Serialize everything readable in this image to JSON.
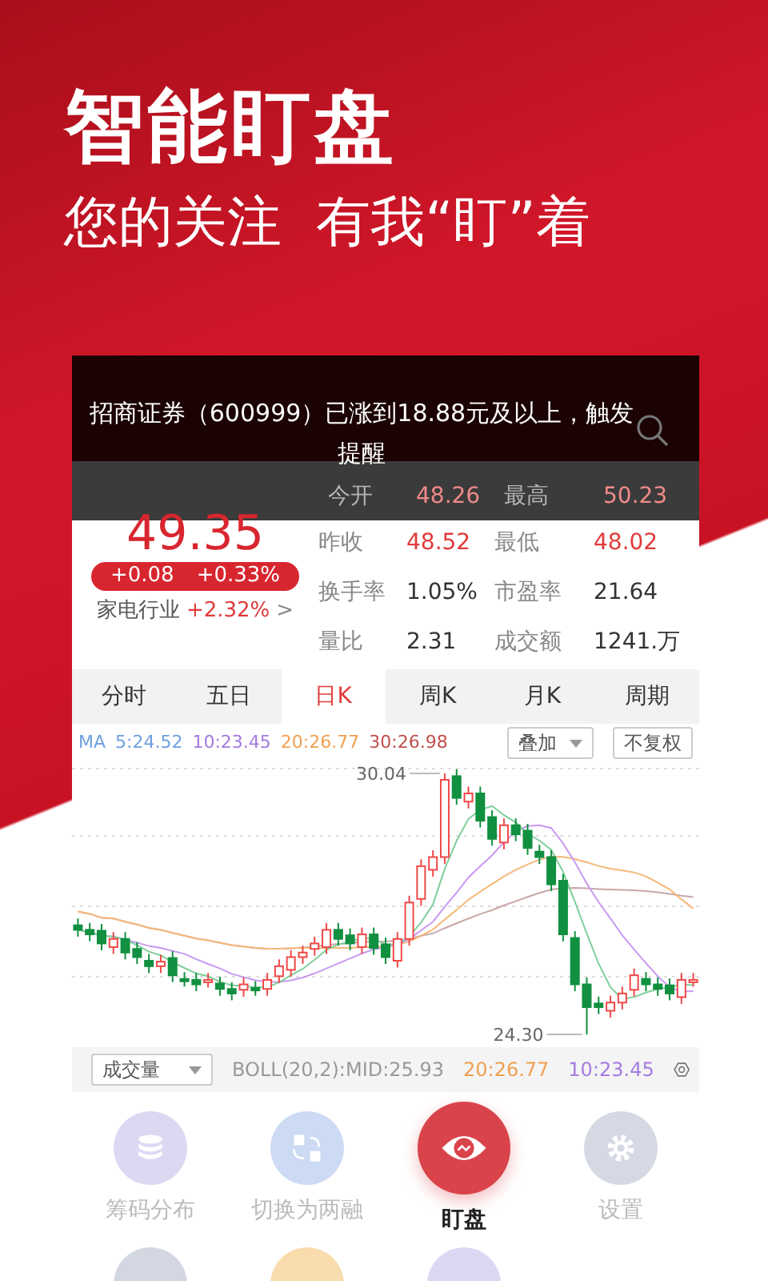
{
  "promo": {
    "headline": "智能盯盘",
    "tagline": "您的关注  有我“盯”着"
  },
  "notification": {
    "text": "招商证券（600999）已涨到18.88元及以上，触发提醒"
  },
  "quote": {
    "price": "49.35",
    "change": "+0.08",
    "change_pct": "+0.33%",
    "sector": "家电行业",
    "sector_pct": "+2.32%",
    "sector_arrow": ">"
  },
  "stats": [
    [
      {
        "label": "今开",
        "value": "48.26",
        "rising": true
      },
      {
        "label": "最高",
        "value": "50.23",
        "rising": true
      }
    ],
    [
      {
        "label": "昨收",
        "value": "48.52",
        "rising": true
      },
      {
        "label": "最低",
        "value": "48.02",
        "rising": true
      }
    ],
    [
      {
        "label": "换手率",
        "value": "1.05%",
        "rising": false
      },
      {
        "label": "市盈率",
        "value": "21.64",
        "rising": false
      }
    ],
    [
      {
        "label": "量比",
        "value": "2.31",
        "rising": false
      },
      {
        "label": "成交额",
        "value": "1241.万",
        "rising": false
      }
    ]
  ],
  "period_tabs": [
    {
      "label": "分时",
      "selected": false
    },
    {
      "label": "五日",
      "selected": false
    },
    {
      "label": "日K",
      "selected": true
    },
    {
      "label": "周K",
      "selected": false
    },
    {
      "label": "月K",
      "selected": false
    },
    {
      "label": "周期",
      "selected": false
    }
  ],
  "ma_legend": {
    "label": "MA",
    "items": [
      {
        "text": "5:24.52",
        "color": "#6f9fe0"
      },
      {
        "text": "10:23.45",
        "color": "#a57be0"
      },
      {
        "text": "20:26.77",
        "color": "#f0a050"
      },
      {
        "text": "30:26.98",
        "color": "#c0504d"
      }
    ]
  },
  "overlay_select": "叠加",
  "adjust_button": "不复权",
  "chart": {
    "high_label": "30.04",
    "low_label": "24.30"
  },
  "indicator_bar": {
    "select": "成交量",
    "items": [
      {
        "text": "BOLL(20,2):MID:25.93",
        "color": "#999999"
      },
      {
        "text": "20:26.77",
        "color": "#f0a050"
      },
      {
        "text": "10:23.45",
        "color": "#a57be0"
      }
    ]
  },
  "actions": [
    {
      "label": "筹码分布",
      "kind": "stack",
      "color": "#dcd8f2",
      "selected": false
    },
    {
      "label": "切换为两融",
      "kind": "swap",
      "color": "#cddaf3",
      "selected": false
    },
    {
      "label": "盯盘",
      "kind": "eye",
      "color": "#d9434a",
      "selected": true
    },
    {
      "label": "设置",
      "kind": "gear",
      "color": "#d6d9e4",
      "selected": false
    },
    {
      "color": "#d3d7e2",
      "selected": false
    },
    {
      "color": "#f9dcae",
      "selected": false
    },
    {
      "color": "#dcd8f2",
      "selected": false
    }
  ]
}
